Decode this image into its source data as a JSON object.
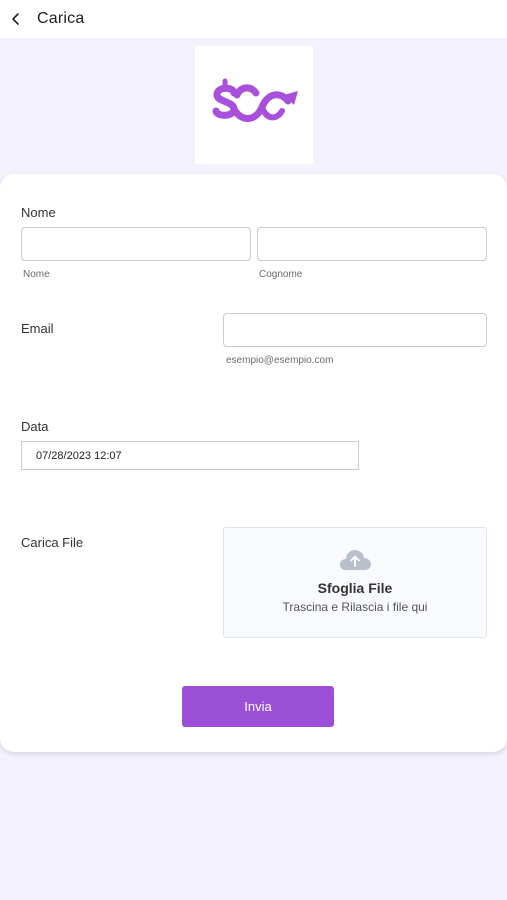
{
  "header": {
    "back_icon": "chevron-left-icon",
    "title": "Carica"
  },
  "logo": {
    "icon": "dollar-infinity-arrow-logo",
    "color": "#a84fdb"
  },
  "form": {
    "name": {
      "label": "Nome",
      "first_value": "",
      "last_value": "",
      "first_sublabel": "Nome",
      "last_sublabel": "Cognome"
    },
    "email": {
      "label": "Email",
      "value": "",
      "sublabel": "esempio@esempio.com"
    },
    "date": {
      "label": "Data",
      "value": "07/28/2023 12:07"
    },
    "file": {
      "label": "Carica File",
      "icon": "cloud-upload-icon",
      "title": "Sfoglia File",
      "subtitle": "Trascina e Rilascia i file qui"
    },
    "submit_label": "Invia"
  },
  "colors": {
    "accent": "#9b4fd6",
    "background": "#f3f2fd"
  }
}
